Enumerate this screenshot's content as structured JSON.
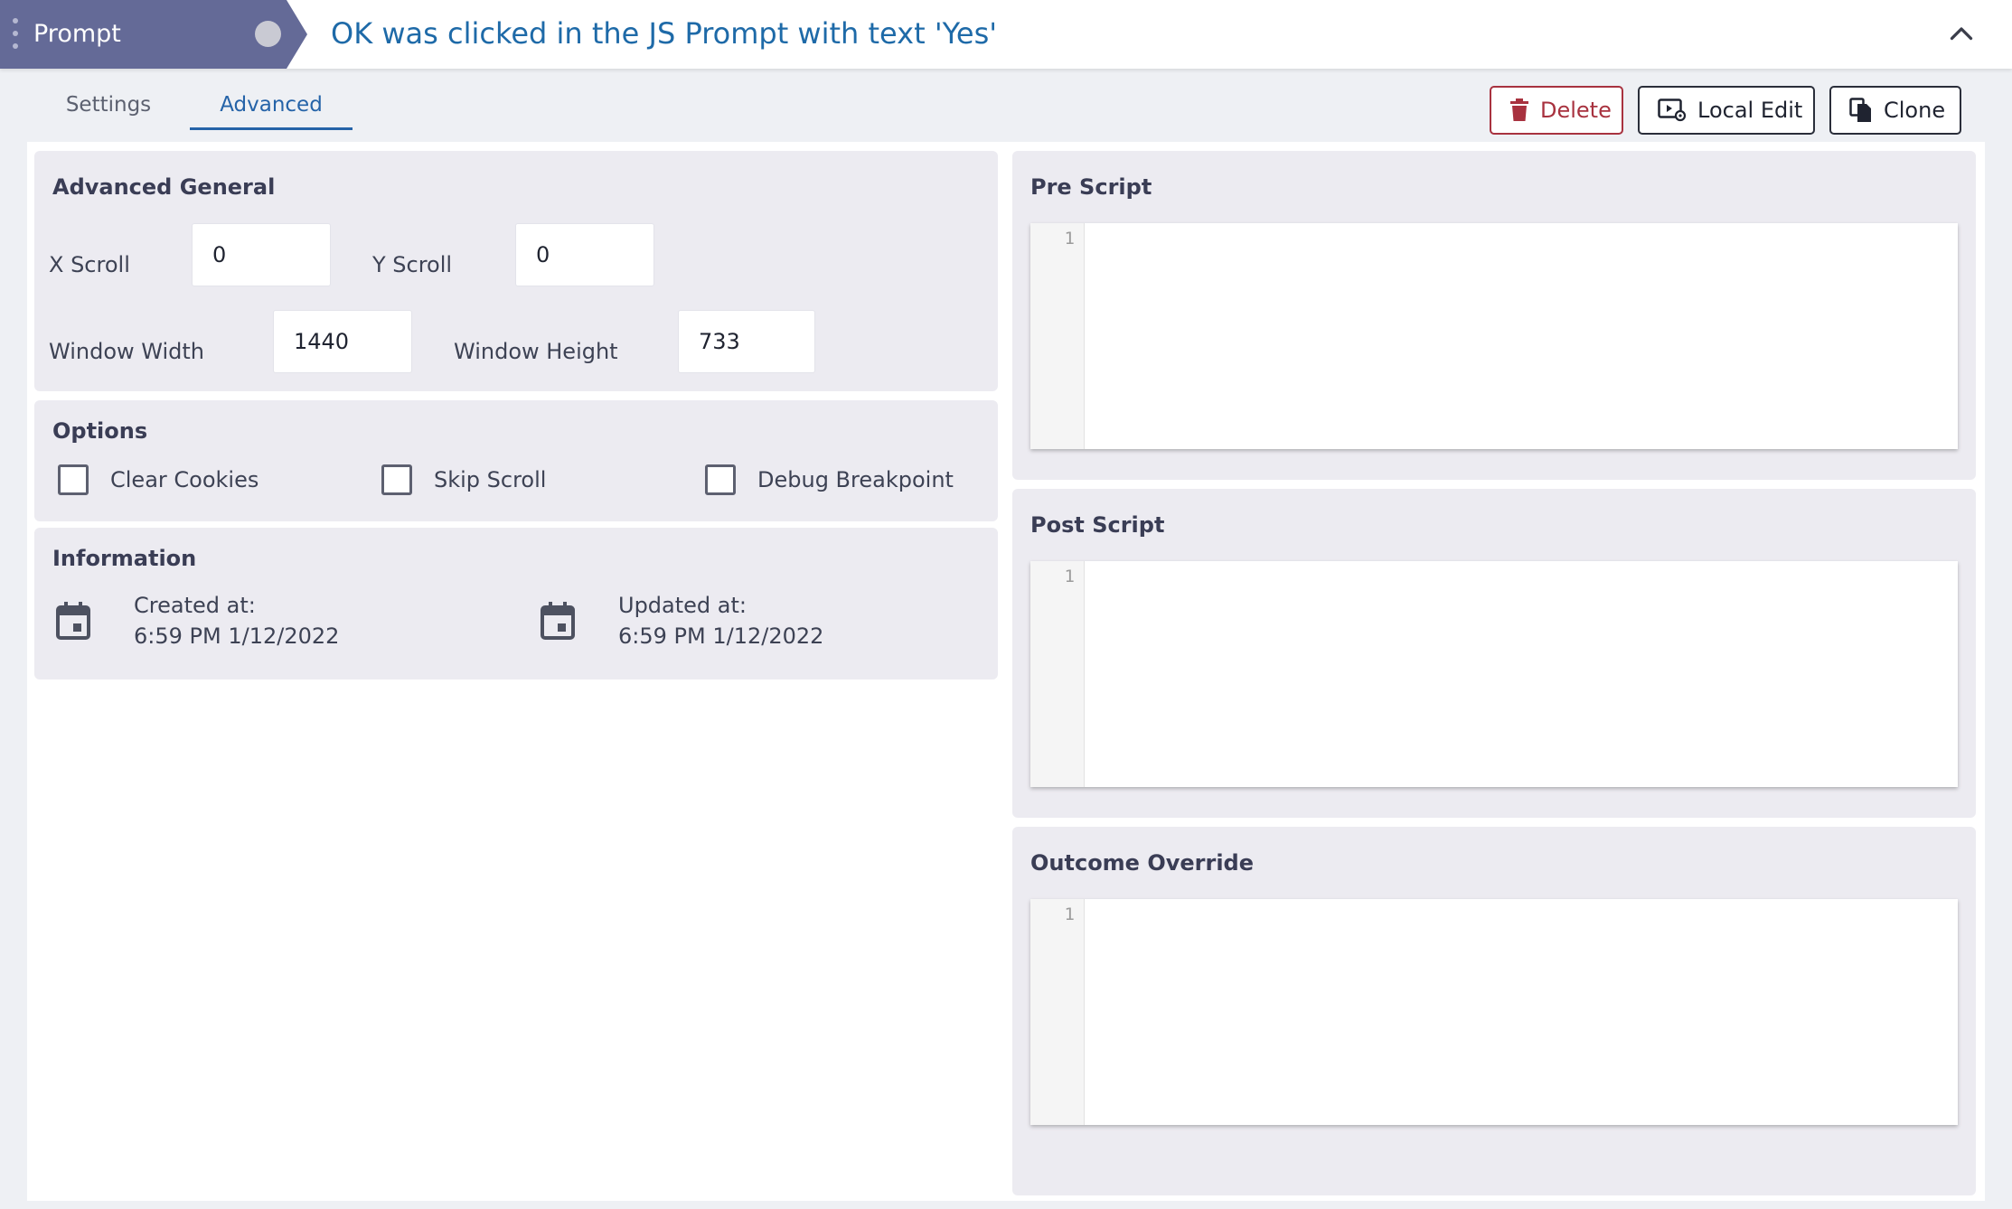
{
  "header": {
    "step_type": "Prompt",
    "title": "OK was clicked in the JS Prompt with text 'Yes'",
    "collapse_icon": "chevron-up-icon"
  },
  "tabs": [
    {
      "label": "Settings",
      "active": false
    },
    {
      "label": "Advanced",
      "active": true
    }
  ],
  "actions": {
    "delete_label": "Delete",
    "local_edit_label": "Local Edit",
    "clone_label": "Clone"
  },
  "advanced_general": {
    "title": "Advanced General",
    "x_scroll_label": "X Scroll",
    "x_scroll_value": "0",
    "y_scroll_label": "Y Scroll",
    "y_scroll_value": "0",
    "window_width_label": "Window Width",
    "window_width_value": "1440",
    "window_height_label": "Window Height",
    "window_height_value": "733"
  },
  "options": {
    "title": "Options",
    "items": [
      {
        "label": "Clear Cookies",
        "checked": false
      },
      {
        "label": "Skip Scroll",
        "checked": false
      },
      {
        "label": "Debug Breakpoint",
        "checked": false
      }
    ]
  },
  "information": {
    "title": "Information",
    "created_label": "Created at:",
    "created_value": "6:59 PM 1/12/2022",
    "updated_label": "Updated at:",
    "updated_value": "6:59 PM 1/12/2022"
  },
  "scripts": {
    "pre_title": "Pre Script",
    "post_title": "Post Script",
    "outcome_title": "Outcome Override",
    "line_number": "1"
  },
  "colors": {
    "tag_bg": "#646a97",
    "accent": "#2563a8",
    "title_blue": "#1e6aa8",
    "danger": "#a8323f",
    "panel_bg": "#ecebf1"
  }
}
